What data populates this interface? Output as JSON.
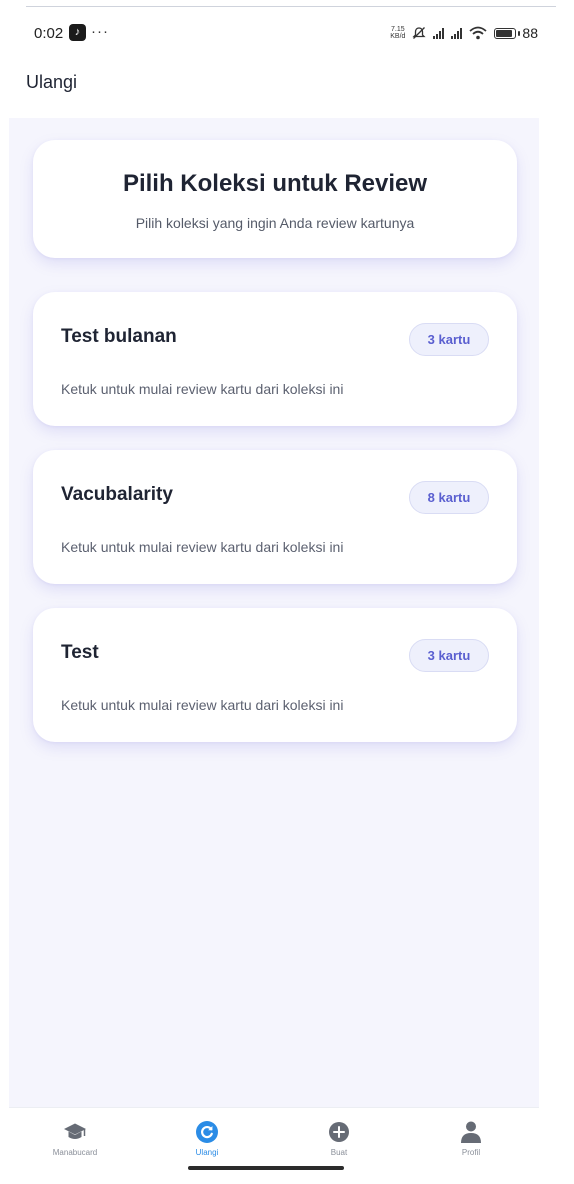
{
  "status_bar": {
    "time": "0:02",
    "dots": "···",
    "net_speed_value": "7.15",
    "net_speed_unit": "KB/d",
    "battery": "88"
  },
  "header": {
    "title": "Ulangi"
  },
  "hero": {
    "title": "Pilih Koleksi untuk Review",
    "subtitle": "Pilih koleksi yang ingin Anda review kartunya"
  },
  "collections": [
    {
      "name": "Test bulanan",
      "count": "3 kartu",
      "hint": "Ketuk untuk mulai review kartu dari koleksi ini"
    },
    {
      "name": "Vacubalarity",
      "count": "8 kartu",
      "hint": "Ketuk untuk mulai review kartu dari koleksi ini"
    },
    {
      "name": "Test",
      "count": "3 kartu",
      "hint": "Ketuk untuk mulai review kartu dari koleksi ini"
    }
  ],
  "nav": [
    {
      "label": "Manabucard",
      "icon": "graduation-cap-icon"
    },
    {
      "label": "Ulangi",
      "icon": "refresh-icon",
      "active": true
    },
    {
      "label": "Buat",
      "icon": "plus-circle-icon"
    },
    {
      "label": "Profil",
      "icon": "person-icon"
    }
  ],
  "colors": {
    "accent": "#2b8ce6",
    "badge_text": "#5a5fd0",
    "background": "#f5f5fd"
  }
}
